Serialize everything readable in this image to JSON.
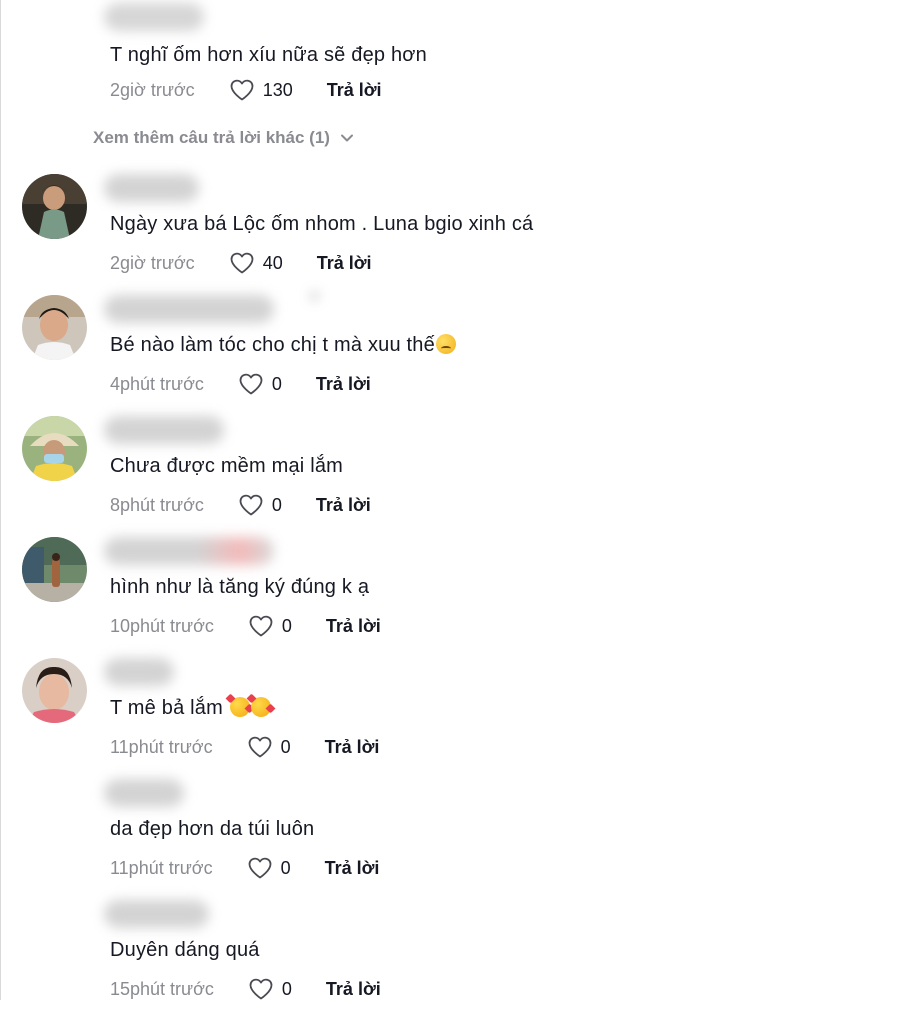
{
  "show_more_replies": "Xem thêm câu trả lời khác (1)",
  "comments": [
    {
      "text": "T nghĩ ốm hơn xíu nữa sẽ đẹp hơn",
      "emoji": "",
      "time": "2giờ trước",
      "likes": "130",
      "reply": "Trả lời"
    },
    {
      "text": "Ngày xưa bá Lộc ốm nhom . Luna bgio xinh cá",
      "emoji": "",
      "time": "2giờ trước",
      "likes": "40",
      "reply": "Trả lời"
    },
    {
      "text": "Bé nào làm tóc cho chị t mà xuu thế",
      "emoji": "sad-face-emoji",
      "time": "4phút trước",
      "likes": "0",
      "reply": "Trả lời"
    },
    {
      "text": "Chưa được mềm mại lắm",
      "emoji": "",
      "time": "8phút trước",
      "likes": "0",
      "reply": "Trả lời"
    },
    {
      "text": "hình như là tăng ký đúng k ạ",
      "emoji": "",
      "time": "10phút trước",
      "likes": "0",
      "reply": "Trả lời"
    },
    {
      "text": "T mê bả lắm ",
      "emoji": "smiling-face-with-hearts-emoji x2",
      "time": "11phút trước",
      "likes": "0",
      "reply": "Trả lời"
    },
    {
      "text": "da đẹp hơn da túi luôn",
      "emoji": "",
      "time": "11phút trước",
      "likes": "0",
      "reply": "Trả lời"
    },
    {
      "text": "Duyên dáng quá",
      "emoji": "",
      "time": "15phút trước",
      "likes": "0",
      "reply": "Trả lời"
    }
  ],
  "icons": {
    "like": "heart-outline-icon",
    "expand": "chevron-down-icon"
  },
  "colors": {
    "text": "#161823",
    "secondary": "#8a8b91",
    "background": "#ffffff"
  }
}
